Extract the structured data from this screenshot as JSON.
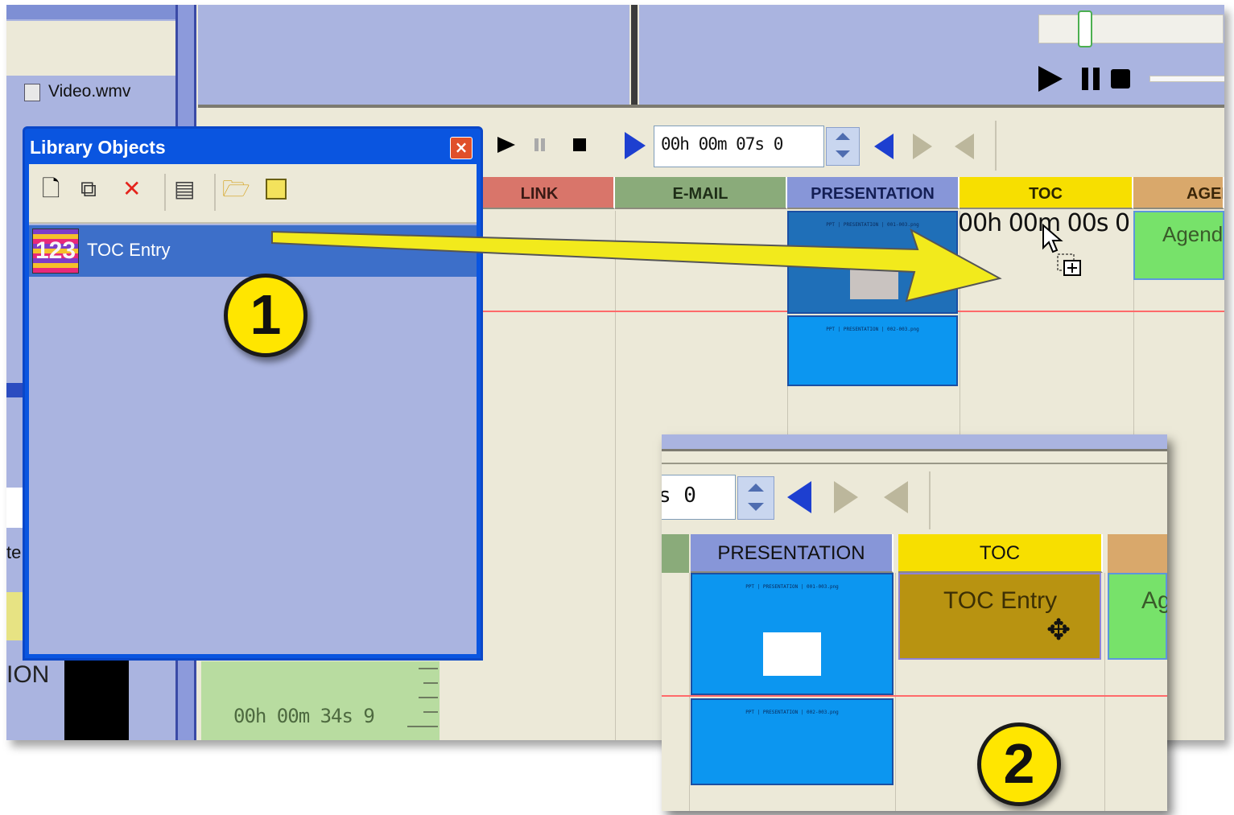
{
  "media_list": {
    "file_name": "Video.wmv",
    "partial_label": "te",
    "track_label_partial": "ION"
  },
  "transport": {
    "slider_level": 0.16,
    "volume_level": 0.0
  },
  "timeline_toolbar": {
    "time_value": "00h 00m 07s 0"
  },
  "tracks": [
    {
      "label": "LINK",
      "color": "#d9756a"
    },
    {
      "label": "E-MAIL",
      "color": "#8aab7a"
    },
    {
      "label": "PRESENTATION",
      "color": "#8796d8"
    },
    {
      "label": "TOC",
      "color": "#f7df00"
    },
    {
      "label": "AGEN",
      "color": "#d9a86b"
    }
  ],
  "toc_cursor_time": "00h 00m 00s 0",
  "agenda_clip_label": "Agend",
  "preview_time": "00h 00m 34s 9",
  "library": {
    "title": "Library Objects",
    "items": [
      {
        "label": "TOC Entry"
      }
    ]
  },
  "callouts": {
    "step1": "1",
    "step2": "2"
  },
  "inset": {
    "time_partial": "s 0",
    "tracks": [
      {
        "label": "PRESENTATION",
        "color": "#8796d8"
      },
      {
        "label": "TOC",
        "color": "#f7df00"
      }
    ],
    "toc_clip_label": "TOC Entry",
    "agenda_partial": "Ag"
  },
  "colors": {
    "arrow": "#f2ea1c",
    "toc_clip": "#b89311",
    "agenda_clip": "#77e26a",
    "playhead": "#ff4a4a"
  }
}
